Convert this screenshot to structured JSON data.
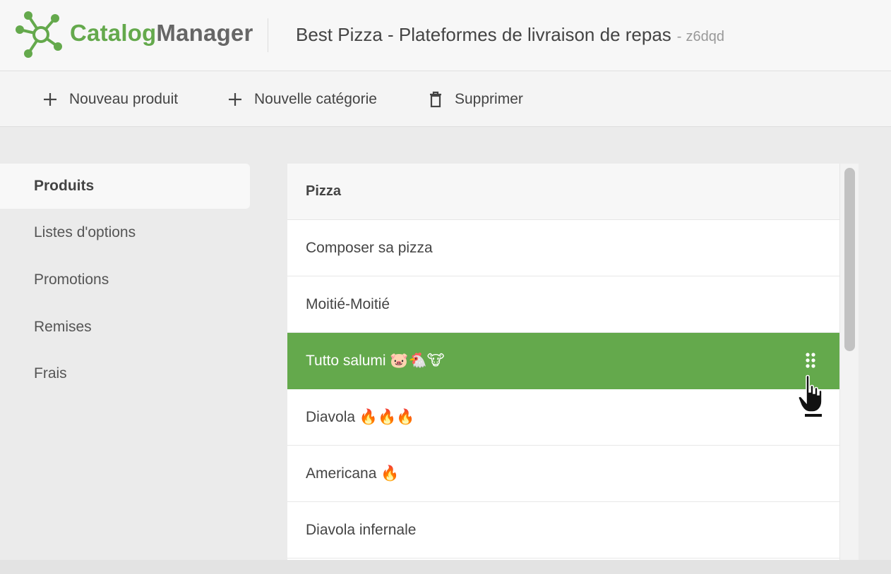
{
  "brand": {
    "part1": "Catalog",
    "part2": "Manager",
    "accent_color": "#64a94c"
  },
  "header": {
    "title": "Best Pizza - Plateformes de livraison de repas",
    "separator": "-",
    "code": "z6dqd"
  },
  "toolbar": {
    "new_product": {
      "label": "Nouveau produit",
      "icon": "plus-icon"
    },
    "new_category": {
      "label": "Nouvelle catégorie",
      "icon": "plus-icon"
    },
    "delete": {
      "label": "Supprimer",
      "icon": "trash-icon"
    }
  },
  "sidebar": {
    "items": [
      {
        "label": "Produits",
        "active": true
      },
      {
        "label": "Listes d'options"
      },
      {
        "label": "Promotions"
      },
      {
        "label": "Remises"
      },
      {
        "label": "Frais"
      }
    ]
  },
  "list": {
    "category": "Pizza",
    "rows": [
      {
        "label": "Composer sa pizza"
      },
      {
        "label": "Moitié-Moitié"
      },
      {
        "label": "Tutto salumi 🐷🐔🐮",
        "selected": true
      },
      {
        "label": "Diavola 🔥🔥🔥"
      },
      {
        "label": "Americana 🔥"
      },
      {
        "label": "Diavola infernale"
      }
    ]
  }
}
